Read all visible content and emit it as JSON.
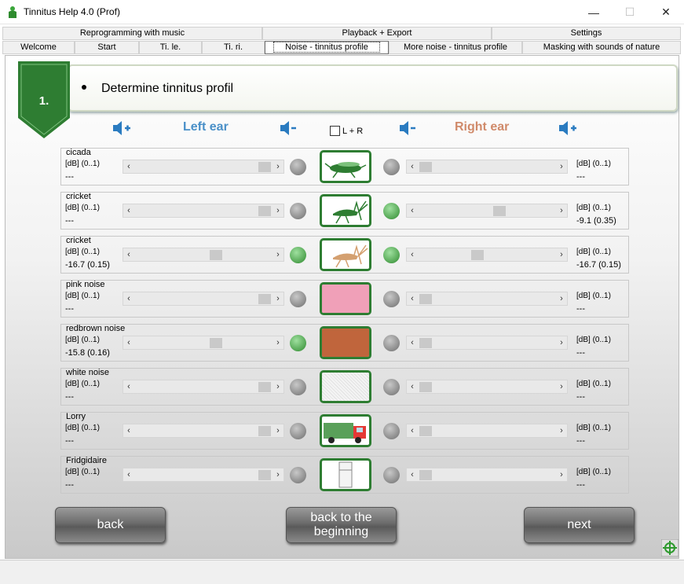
{
  "window": {
    "title": "Tinnitus Help 4.0 (Prof)",
    "minimize": "—",
    "maximize": "☐",
    "close": "✕"
  },
  "tabs_row1": [
    "Reprogramming with music",
    "Playback + Export",
    "Settings"
  ],
  "tabs_row2": [
    "Welcome",
    "Start",
    "Ti. le.",
    "Ti. ri.",
    "Noise - tinnitus profile",
    "More noise - tinnitus profile",
    "Masking with sounds of nature"
  ],
  "active_tab": "Noise - tinnitus profile",
  "step": {
    "number": "1.",
    "title": "Determine tinnitus profil"
  },
  "headers": {
    "left_ear": "Left ear",
    "right_ear": "Right ear",
    "lr_label": "L + R",
    "left_color": "#4a90c8",
    "right_color": "#d08a6a"
  },
  "rows": [
    {
      "name": "cicada",
      "db_left": "[dB] (0..1)",
      "val_left": "---",
      "led_left": "off",
      "db_right": "[dB] (0..1)",
      "val_right": "---",
      "led_right": "off",
      "left_level": 1.0,
      "right_level": 0.0,
      "picture": "cicada-icon"
    },
    {
      "name": "cricket",
      "db_left": "[dB] (0..1)",
      "val_left": "---",
      "led_left": "off",
      "db_right": "[dB] (0..1)",
      "val_right": "-9.1 (0.35)",
      "led_right": "on",
      "left_level": 1.0,
      "right_level": 0.6,
      "picture": "cricket-icon"
    },
    {
      "name": "cricket",
      "db_left": "[dB] (0..1)",
      "val_left": "-16.7 (0.15)",
      "led_left": "on",
      "db_right": "[dB] (0..1)",
      "val_right": "-16.7 (0.15)",
      "led_right": "on",
      "left_level": 0.6,
      "right_level": 0.42,
      "picture": "cricket-icon"
    },
    {
      "name": "pink noise",
      "db_left": "[dB] (0..1)",
      "val_left": "---",
      "led_left": "off",
      "db_right": "[dB] (0..1)",
      "val_right": "---",
      "led_right": "off",
      "left_level": 1.0,
      "right_level": 0.0,
      "picture": "pink-noise-swatch"
    },
    {
      "name": "redbrown noise",
      "db_left": "[dB] (0..1)",
      "val_left": "-15.8 (0.16)",
      "led_left": "on",
      "db_right": "[dB] (0..1)",
      "val_right": "---",
      "led_right": "off",
      "left_level": 0.6,
      "right_level": 0.0,
      "picture": "redbrown-noise-swatch"
    },
    {
      "name": "white noise",
      "db_left": "[dB] (0..1)",
      "val_left": "---",
      "led_left": "off",
      "db_right": "[dB] (0..1)",
      "val_right": "---",
      "led_right": "off",
      "left_level": 1.0,
      "right_level": 0.0,
      "picture": "white-noise-swatch"
    },
    {
      "name": "Lorry",
      "db_left": "[dB] (0..1)",
      "val_left": "---",
      "led_left": "off",
      "db_right": "[dB] (0..1)",
      "val_right": "---",
      "led_right": "off",
      "left_level": 1.0,
      "right_level": 0.0,
      "picture": "lorry-icon"
    },
    {
      "name": "Fridgidaire",
      "db_left": "[dB] (0..1)",
      "val_left": "---",
      "led_left": "off",
      "db_right": "[dB] (0..1)",
      "val_right": "---",
      "led_right": "off",
      "left_level": 1.0,
      "right_level": 0.0,
      "picture": "fridge-icon"
    }
  ],
  "buttons": {
    "back": "back",
    "back_to_beginning_line1": "back to the",
    "back_to_beginning_line2": "beginning",
    "next": "next"
  },
  "colors": {
    "badge_green": "#2e7d32",
    "led_on": "#3a9a3a",
    "pink": "#f0a0b8",
    "redbrown": "#c0653c"
  }
}
